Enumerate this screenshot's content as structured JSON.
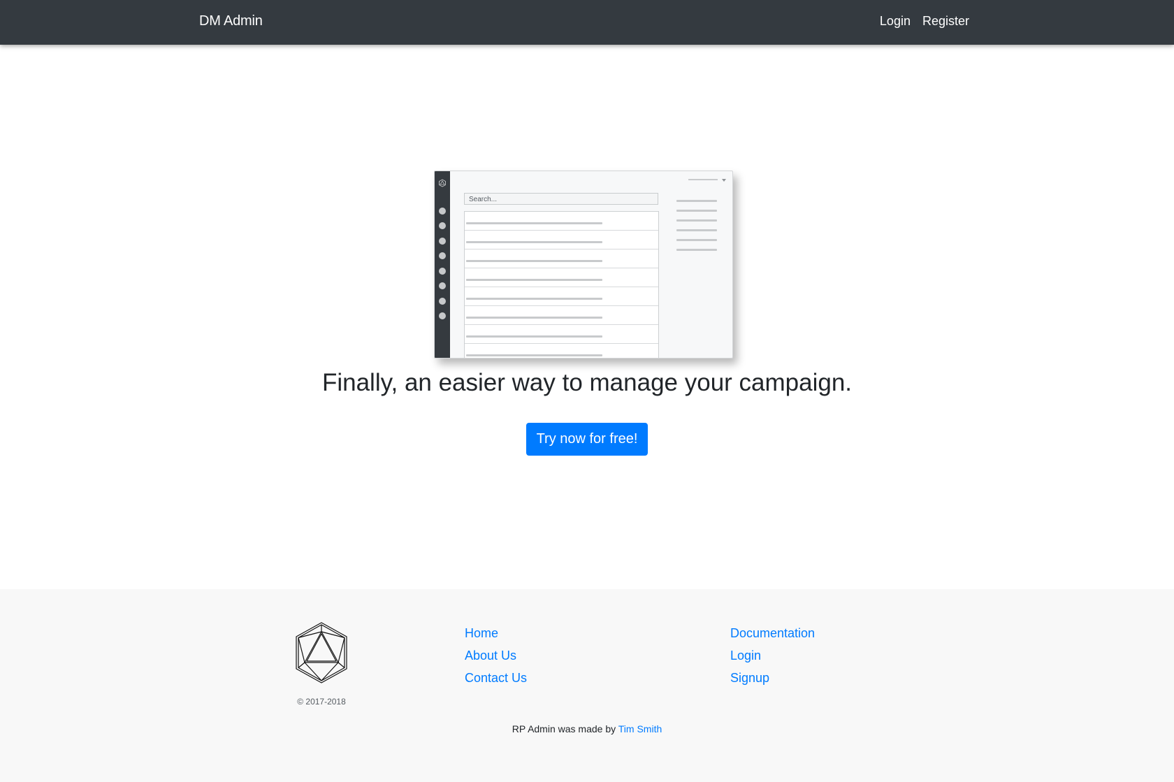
{
  "navbar": {
    "brand": "DM Admin",
    "links": [
      {
        "label": "Login"
      },
      {
        "label": "Register"
      }
    ]
  },
  "hero": {
    "mockup": {
      "search_placeholder": "Search..."
    },
    "headline": "Finally, an easier way to manage your campaign.",
    "cta_label": "Try now for free!",
    "cta_color": "#007bff"
  },
  "footer": {
    "copyright": "© 2017-2018",
    "col1": [
      {
        "label": "Home"
      },
      {
        "label": "About Us"
      },
      {
        "label": "Contact Us"
      }
    ],
    "col2": [
      {
        "label": "Documentation"
      },
      {
        "label": "Login"
      },
      {
        "label": "Signup"
      }
    ],
    "credits_prefix": "RP Admin was made by",
    "credits_author": "Tim Smith"
  },
  "colors": {
    "navbar_bg": "#343a40",
    "link": "#007bff",
    "footer_bg": "#f8f8f8"
  }
}
